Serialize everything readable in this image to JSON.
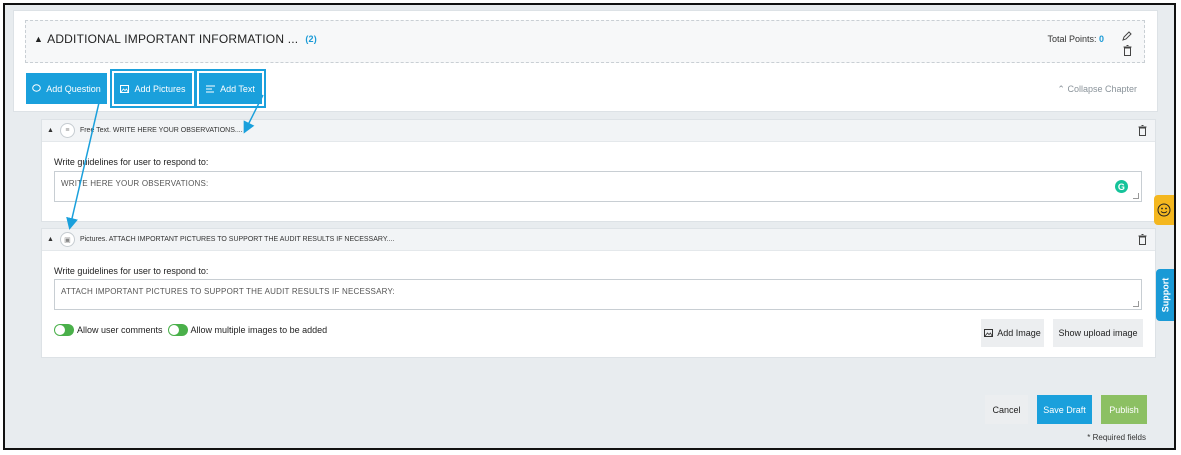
{
  "chapter": {
    "title": "ADDITIONAL IMPORTANT INFORMATION ...",
    "count": "(2)",
    "total_points_label": "Total Points:",
    "total_points_value": "0",
    "collapse_label": "Collapse Chapter"
  },
  "toolbar": {
    "add_question": "Add Question",
    "add_pictures": "Add Pictures",
    "add_text": "Add Text"
  },
  "questions": [
    {
      "header": "Free Text. WRITE HERE YOUR OBSERVATIONS....",
      "guideline_label": "Write guidelines for user to respond to:",
      "guideline_value": "WRITE HERE YOUR OBSERVATIONS:"
    },
    {
      "header": "Pictures. ATTACH IMPORTANT PICTURES TO SUPPORT THE AUDIT RESULTS IF NECESSARY....",
      "guideline_label": "Write guidelines for user to respond to:",
      "guideline_value": "ATTACH IMPORTANT PICTURES TO SUPPORT THE AUDIT RESULTS IF NECESSARY:",
      "allow_comments": "Allow user comments",
      "allow_multiple": "Allow multiple images to be added",
      "add_image": "Add Image",
      "show_upload": "Show upload image"
    }
  ],
  "footer": {
    "cancel": "Cancel",
    "save_draft": "Save Draft",
    "publish": "Publish",
    "required_note": "* Required fields"
  },
  "side": {
    "support": "Support"
  },
  "colors": {
    "accent": "#1aa0dc",
    "publish": "#8cc063",
    "toggle_on": "#4ab04a",
    "feedback_tab": "#f4b71f"
  }
}
